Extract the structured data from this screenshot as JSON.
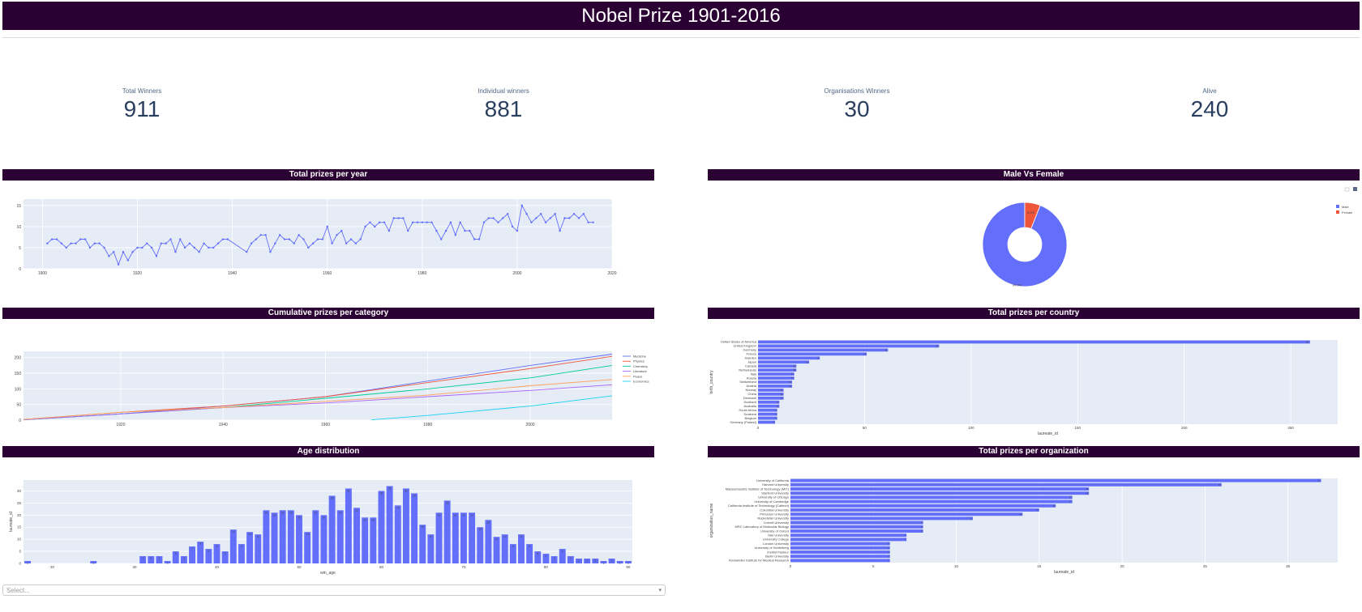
{
  "page_title": "Nobel Prize 1901-2016",
  "kpis": [
    {
      "label": "Total Winners",
      "value": "911"
    },
    {
      "label": "Individual winners",
      "value": "881"
    },
    {
      "label": "Organisations Winners",
      "value": "30"
    },
    {
      "label": "Alive",
      "value": "240"
    }
  ],
  "sections": {
    "prizes_per_year": "Total prizes per year",
    "male_female": "Male Vs Female",
    "cumulative": "Cumulative prizes per category",
    "country": "Total prizes per country",
    "age": "Age distribution",
    "organization": "Total prizes per organization"
  },
  "dropdown": {
    "placeholder": "Select...",
    "caret": "▾"
  },
  "colors": {
    "primary": "#636efa",
    "header_bg": "#2b0033",
    "plot_bg": "#e5ecf6",
    "female": "#ef553b"
  },
  "chart_data": [
    {
      "id": "prizes_per_year",
      "type": "line",
      "title": "Total prizes per year",
      "x_ticks": [
        1900,
        1920,
        1940,
        1960,
        1980,
        2000,
        2020
      ],
      "y_ticks": [
        0,
        5,
        10,
        15
      ],
      "xlim": [
        1896,
        2020
      ],
      "ylim": [
        0,
        16.5
      ],
      "x": [
        1901,
        1902,
        1903,
        1904,
        1905,
        1906,
        1907,
        1908,
        1909,
        1910,
        1911,
        1912,
        1913,
        1914,
        1915,
        1916,
        1917,
        1918,
        1919,
        1920,
        1921,
        1922,
        1923,
        1924,
        1925,
        1926,
        1927,
        1928,
        1929,
        1930,
        1931,
        1932,
        1933,
        1934,
        1935,
        1936,
        1937,
        1938,
        1939,
        1943,
        1944,
        1945,
        1946,
        1947,
        1948,
        1949,
        1950,
        1951,
        1952,
        1953,
        1954,
        1955,
        1956,
        1957,
        1958,
        1959,
        1960,
        1961,
        1962,
        1963,
        1964,
        1965,
        1966,
        1967,
        1968,
        1969,
        1970,
        1971,
        1972,
        1973,
        1974,
        1975,
        1976,
        1977,
        1978,
        1979,
        1980,
        1981,
        1982,
        1983,
        1984,
        1985,
        1986,
        1987,
        1988,
        1989,
        1990,
        1991,
        1992,
        1993,
        1994,
        1995,
        1996,
        1997,
        1998,
        1999,
        2000,
        2001,
        2002,
        2003,
        2004,
        2005,
        2006,
        2007,
        2008,
        2009,
        2010,
        2011,
        2012,
        2013,
        2014,
        2015,
        2016
      ],
      "y": [
        6,
        7,
        7,
        6,
        5,
        6,
        6,
        7,
        7,
        5,
        6,
        6,
        5,
        3,
        4,
        1,
        4,
        2,
        4,
        5,
        5,
        6,
        5,
        3,
        6,
        6,
        7,
        4,
        7,
        5,
        6,
        5,
        4,
        6,
        5,
        5,
        6,
        7,
        7,
        4,
        6,
        7,
        8,
        8,
        4,
        6,
        8,
        7,
        7,
        6,
        8,
        7,
        5,
        6,
        7,
        7,
        10,
        6,
        8,
        9,
        6,
        7,
        6,
        7,
        10,
        11,
        10,
        11,
        11,
        9,
        12,
        12,
        12,
        9,
        11,
        11,
        11,
        11,
        11,
        9,
        7,
        9,
        11,
        8,
        11,
        9,
        9,
        7,
        7,
        11,
        12,
        12,
        11,
        12,
        13,
        10,
        9,
        15,
        13,
        11,
        12,
        13,
        11,
        12,
        13,
        9,
        12,
        12,
        13,
        12,
        13,
        11,
        11
      ]
    },
    {
      "id": "male_female",
      "type": "pie",
      "title": "Male Vs Female",
      "categories": [
        "Male",
        "Female"
      ],
      "values": [
        94.0,
        6.0
      ],
      "labels": [
        "94.0%",
        "6.0%"
      ],
      "legend": "top-right"
    },
    {
      "id": "cumulative",
      "type": "line",
      "title": "Cumulative prizes per category",
      "x_ticks": [
        1920,
        1940,
        1960,
        1980,
        2000
      ],
      "y_ticks": [
        0,
        50,
        100,
        150,
        200
      ],
      "xlim": [
        1901,
        2016
      ],
      "ylim": [
        0,
        220
      ],
      "series": [
        {
          "name": "Medicine",
          "color": "#636efa",
          "x": [
            1901,
            1920,
            1940,
            1960,
            1980,
            2000,
            2016
          ],
          "y": [
            1,
            20,
            45,
            75,
            125,
            175,
            211
          ]
        },
        {
          "name": "Physics",
          "color": "#ef553b",
          "x": [
            1901,
            1920,
            1940,
            1960,
            1980,
            2000,
            2016
          ],
          "y": [
            2,
            25,
            45,
            75,
            120,
            165,
            204
          ]
        },
        {
          "name": "Chemistry",
          "color": "#00cc96",
          "x": [
            1901,
            1920,
            1940,
            1960,
            1980,
            2000,
            2016
          ],
          "y": [
            1,
            20,
            40,
            70,
            100,
            135,
            175
          ]
        },
        {
          "name": "Literature",
          "color": "#ab63fa",
          "x": [
            1901,
            1920,
            1940,
            1960,
            1980,
            2000,
            2016
          ],
          "y": [
            1,
            20,
            40,
            55,
            75,
            95,
            113
          ]
        },
        {
          "name": "Peace",
          "color": "#ffa15a",
          "x": [
            1901,
            1920,
            1940,
            1960,
            1980,
            2000,
            2016
          ],
          "y": [
            2,
            25,
            40,
            60,
            80,
            110,
            130
          ]
        },
        {
          "name": "Economics",
          "color": "#19d3f3",
          "x": [
            1969,
            1980,
            2000,
            2016
          ],
          "y": [
            1,
            15,
            45,
            78
          ]
        }
      ]
    },
    {
      "id": "country",
      "type": "bar",
      "orientation": "h",
      "title": "Total prizes per country",
      "xlabel": "laureate_id",
      "ylabel": "birth_country",
      "x_ticks": [
        0,
        50,
        100,
        150,
        200,
        250
      ],
      "xlim": [
        0,
        272
      ],
      "categories": [
        "United States of America",
        "United Kingdom",
        "Germany",
        "France",
        "Sweden",
        "Japan",
        "Canada",
        "Netherlands",
        "Italy",
        "Russia",
        "Switzerland",
        "Austria",
        "Norway",
        "China",
        "Denmark",
        "Scotland",
        "Australia",
        "South Africa",
        "Scotland",
        "Belgium",
        "Germany (Poland)"
      ],
      "values": [
        259,
        85,
        61,
        51,
        29,
        24,
        18,
        18,
        17,
        17,
        16,
        16,
        12,
        12,
        12,
        10,
        10,
        9,
        9,
        9,
        8
      ]
    },
    {
      "id": "age",
      "type": "bar",
      "title": "Age distribution",
      "xlabel": "win_age",
      "ylabel": "laureate_id",
      "x_ticks": [
        20,
        30,
        40,
        50,
        60,
        70,
        80,
        90
      ],
      "y_ticks": [
        0,
        5,
        10,
        15,
        20,
        25,
        30
      ],
      "ylim": [
        0,
        34.5
      ],
      "categories": [
        17,
        25,
        31,
        32,
        33,
        34,
        35,
        36,
        37,
        38,
        39,
        40,
        41,
        42,
        43,
        44,
        45,
        46,
        47,
        48,
        49,
        50,
        51,
        52,
        53,
        54,
        55,
        56,
        57,
        58,
        59,
        60,
        61,
        62,
        63,
        64,
        65,
        66,
        67,
        68,
        69,
        70,
        71,
        72,
        73,
        74,
        75,
        76,
        77,
        78,
        79,
        80,
        81,
        82,
        83,
        84,
        85,
        86,
        87,
        88,
        89,
        90
      ],
      "values": [
        1,
        1,
        3,
        3,
        3,
        1,
        5,
        3,
        7,
        9,
        6,
        8,
        5,
        14,
        8,
        13,
        12,
        22,
        21,
        22,
        22,
        20,
        13,
        22,
        20,
        28,
        22,
        31,
        23,
        19,
        19,
        30,
        32,
        24,
        31,
        29,
        16,
        12,
        21,
        26,
        21,
        21,
        21,
        15,
        18,
        11,
        12,
        8,
        12,
        8,
        5,
        4,
        3,
        6,
        3,
        2,
        2,
        2,
        1,
        2,
        1,
        1
      ]
    },
    {
      "id": "organization",
      "type": "bar",
      "orientation": "h",
      "title": "Total prizes per organization",
      "xlabel": "laureate_id",
      "ylabel": "organization_name",
      "x_ticks": [
        0,
        5,
        10,
        15,
        20,
        25,
        30
      ],
      "xlim": [
        0,
        33
      ],
      "categories": [
        "University of California",
        "Harvard University",
        "Massachusetts Institute of Technology (MIT)",
        "Stanford University",
        "University of Chicago",
        "University of Cambridge",
        "California Institute of Technology (Caltech)",
        "Columbia University",
        "Princeton University",
        "Rockefeller University",
        "Cornell University",
        "MRC Laboratory of Molecular Biology",
        "University of Oxford",
        "Yale University",
        "University College",
        "London University",
        "University of Heidelberg",
        "Institut Pasteur",
        "Berlin University",
        "Rockefeller Institute for Medical Research"
      ],
      "values": [
        32,
        26,
        18,
        18,
        17,
        17,
        16,
        15,
        14,
        11,
        8,
        8,
        8,
        7,
        7,
        6,
        6,
        6,
        6,
        6
      ]
    }
  ]
}
